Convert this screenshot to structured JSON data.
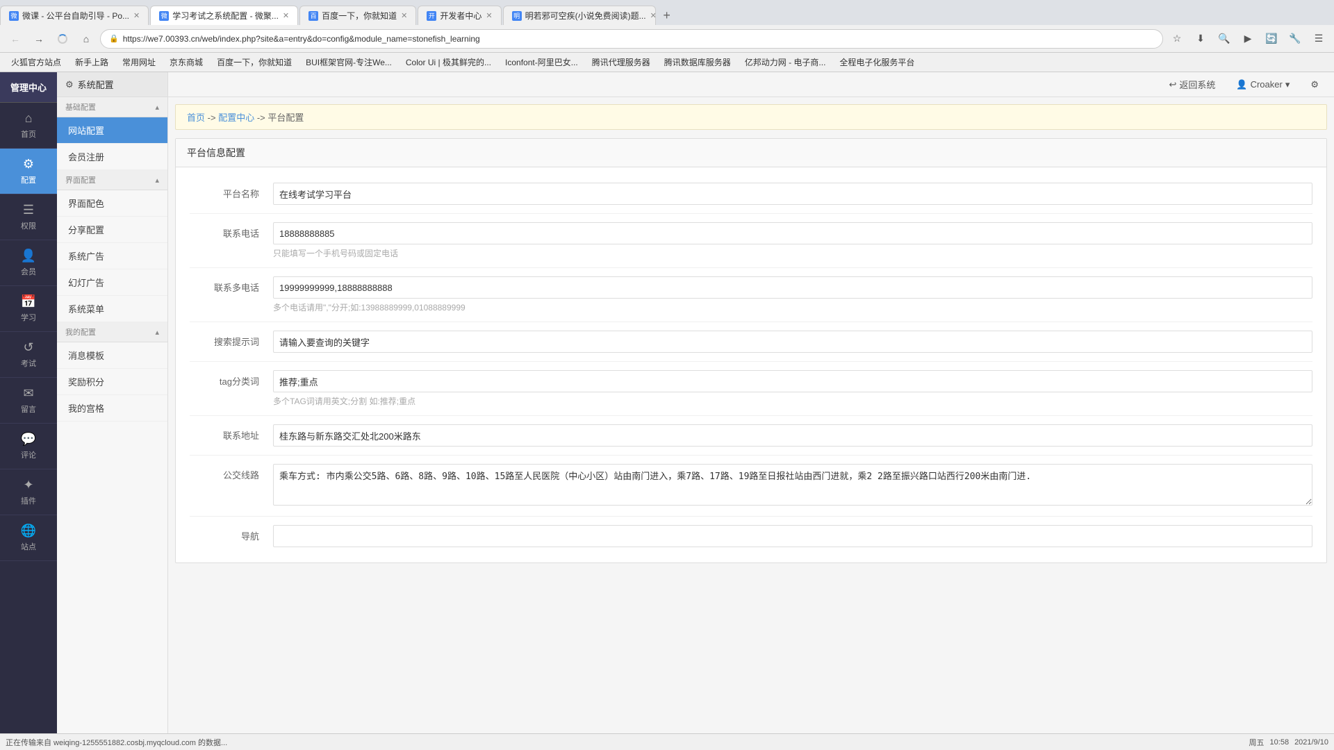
{
  "browser": {
    "tabs": [
      {
        "id": "tab1",
        "title": "微课 - 公平台自助引导 - Po...",
        "icon": "微",
        "active": false
      },
      {
        "id": "tab2",
        "title": "学习考试之系统配置 - 微聚...",
        "icon": "微",
        "active": true
      },
      {
        "id": "tab3",
        "title": "百度一下，你就知道",
        "icon": "百",
        "active": false
      },
      {
        "id": "tab4",
        "title": "开发者中心",
        "icon": "开",
        "active": false
      },
      {
        "id": "tab5",
        "title": "明若邪可空疾(小说免费阅读)题...",
        "icon": "明",
        "active": false
      }
    ],
    "url": "https://we7.00393.cn/web/index.php?site&a=entry&do=config&module_name=stonefish_learning",
    "bookmarks": [
      "火狐官方站点",
      "新手上路",
      "常用网址",
      "京东商城",
      "百度一下，你就知道",
      "BUI框架官网-专注We...",
      "Color Ui | 极其鲜完的...",
      "Iconfont-阿里巴女...",
      "腾讯代理服务器",
      "腾讯数据库服务器",
      "亿邦动力网 - 电子商...",
      "全程电子化服务平台"
    ]
  },
  "topbar": {
    "return_label": "返回系统",
    "user_label": "Croaker",
    "settings_icon": "⚙"
  },
  "sidebar": {
    "header": "管理中心",
    "items": [
      {
        "id": "home",
        "label": "首页",
        "icon": "⌂"
      },
      {
        "id": "config",
        "label": "配置",
        "icon": "⚙"
      },
      {
        "id": "permissions",
        "label": "权限",
        "icon": "☰"
      },
      {
        "id": "members",
        "label": "会员",
        "icon": "👤"
      },
      {
        "id": "learning",
        "label": "学习",
        "icon": "📅"
      },
      {
        "id": "exam",
        "label": "考试",
        "icon": "↺"
      },
      {
        "id": "messages",
        "label": "留言",
        "icon": "✉"
      },
      {
        "id": "comments",
        "label": "评论",
        "icon": "💬"
      },
      {
        "id": "plugins",
        "label": "插件",
        "icon": "✦"
      },
      {
        "id": "sites",
        "label": "站点",
        "icon": "🌐"
      }
    ]
  },
  "secondary_sidebar": {
    "system_config_label": "系统配置",
    "sections": [
      {
        "id": "basic",
        "label": "基础配置",
        "icon": "▴",
        "items": [
          {
            "id": "website_config",
            "label": "网站配置",
            "active": true
          },
          {
            "id": "member_register",
            "label": "会员注册"
          }
        ]
      },
      {
        "id": "interface",
        "label": "界面配置",
        "icon": "▴",
        "items": [
          {
            "id": "interface_color",
            "label": "界面配色"
          },
          {
            "id": "share_config",
            "label": "分享配置"
          },
          {
            "id": "system_ad",
            "label": "系统广告"
          },
          {
            "id": "slideshow_ad",
            "label": "幻灯广告"
          },
          {
            "id": "system_menu",
            "label": "系统菜单"
          }
        ]
      },
      {
        "id": "my",
        "label": "我的配置",
        "icon": "▴",
        "items": [
          {
            "id": "message_template",
            "label": "消息模板"
          },
          {
            "id": "reward_points",
            "label": "奖励积分"
          },
          {
            "id": "my_palace",
            "label": "我的宫格"
          }
        ]
      }
    ]
  },
  "breadcrumb": {
    "items": [
      "首页",
      "配置中心",
      "平台配置"
    ],
    "separators": [
      "->",
      "->"
    ]
  },
  "page": {
    "section_title": "平台信息配置",
    "form_fields": [
      {
        "id": "platform_name",
        "label": "平台名称",
        "value": "在线考试学习平台",
        "hint": "",
        "type": "input"
      },
      {
        "id": "contact_phone",
        "label": "联系电话",
        "value": "18888888885",
        "hint": "只能填写一个手机号码或固定电话",
        "type": "input"
      },
      {
        "id": "multiple_phones",
        "label": "联系多电话",
        "value": "19999999999,18888888888",
        "hint": "多个电话请用\",\"分开;如:13988889999,01088889999",
        "type": "input"
      },
      {
        "id": "search_hint",
        "label": "搜索提示词",
        "value": "请输入要查询的关键字",
        "hint": "",
        "type": "input"
      },
      {
        "id": "tag_category",
        "label": "tag分类词",
        "value": "推荐;重点",
        "hint": "多个TAG词请用英文;分割 如:推荐;重点",
        "type": "input"
      },
      {
        "id": "contact_address",
        "label": "联系地址",
        "value": "桂东路与新东路交汇处北200米路东",
        "hint": "",
        "type": "input"
      },
      {
        "id": "bus_route",
        "label": "公交线路",
        "value": "乘车方式: 市内乘公交5路、6路、8路、9路、10路、15路至人民医院（中心小区）站由南门进入，乘7路、17路、19路至日报社站由西门进就，乘2 2路至振兴路口站西行200米由南门进.",
        "hint": "",
        "type": "textarea"
      },
      {
        "id": "navigation",
        "label": "导航",
        "value": "",
        "hint": "",
        "type": "input"
      }
    ]
  },
  "status_bar": {
    "loading_text": "正在传输来自 weiqing-1255551882.cosbj.myqcloud.com 的数据...",
    "time": "10:58",
    "date": "2021/9/10",
    "day": "周五"
  }
}
